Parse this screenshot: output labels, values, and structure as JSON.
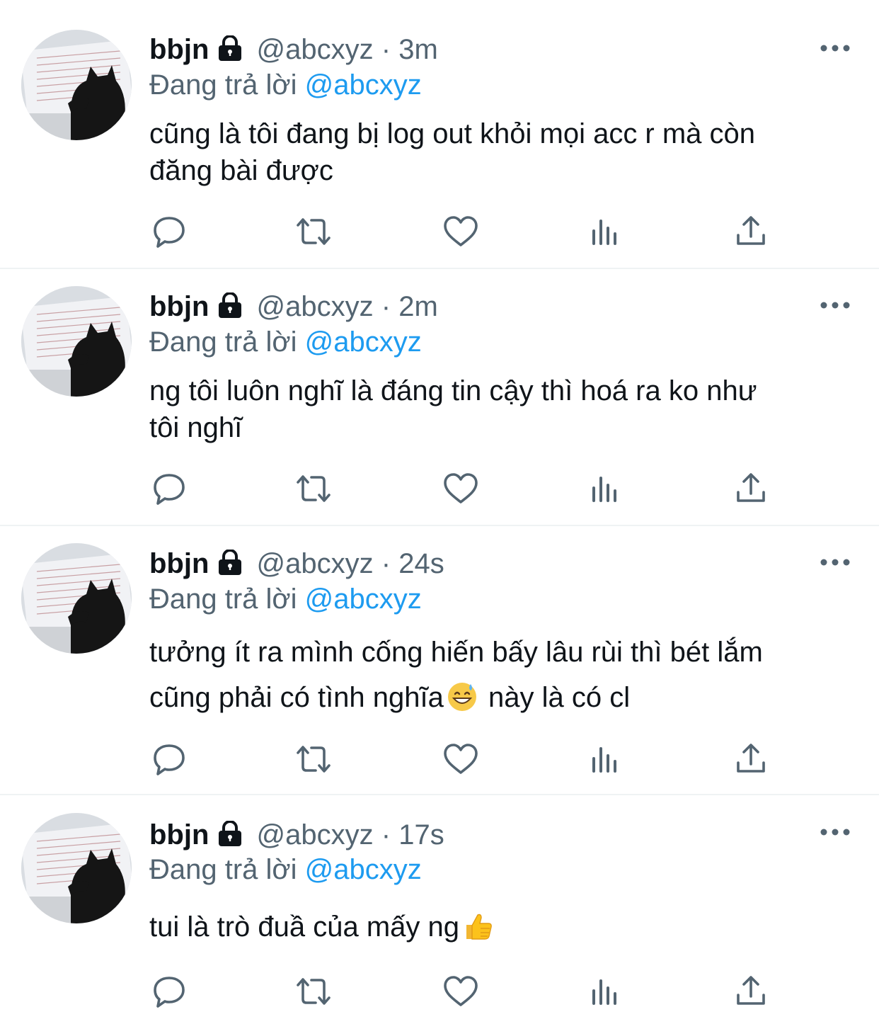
{
  "accent_color": "#1d9bf0",
  "text_secondary_color": "#536471",
  "icons": {
    "reply": "reply-icon",
    "retweet": "retweet-icon",
    "like": "like-icon",
    "views": "views-icon",
    "share": "share-icon",
    "more": "more-icon",
    "lock": "lock-icon"
  },
  "tweets": [
    {
      "name": "bbjn",
      "handle": "@abcxyz",
      "separator": "·",
      "time": "3m",
      "replying_prefix": "Đang trả lời",
      "replying_to": "@abcxyz",
      "text_line1": "cũng là tôi đang bị log out khỏi mọi acc r mà còn",
      "text_line2": "đăng bài được"
    },
    {
      "name": "bbjn",
      "handle": "@abcxyz",
      "separator": "·",
      "time": "2m",
      "replying_prefix": "Đang trả lời",
      "replying_to": "@abcxyz",
      "text_line1": "ng tôi luôn nghĩ là đáng tin cậy thì hoá ra ko như",
      "text_line2": "tôi nghĩ"
    },
    {
      "name": "bbjn",
      "handle": "@abcxyz",
      "separator": "·",
      "time": "24s",
      "replying_prefix": "Đang trả lời",
      "replying_to": "@abcxyz",
      "text_line1": "tưởng ít ra mình cống hiến bấy lâu rùi thì bét lắm",
      "text_line2a": "cũng phải có tình nghĩa",
      "emoji": "grinning-sweat-emoji",
      "text_line2b": " này là có cl"
    },
    {
      "name": "bbjn",
      "handle": "@abcxyz",
      "separator": "·",
      "time": "17s",
      "replying_prefix": "Đang trả lời",
      "replying_to": "@abcxyz",
      "text_line1": "tui là trò đuầ của mấy ng",
      "emoji": "thumbs-up-emoji"
    }
  ]
}
